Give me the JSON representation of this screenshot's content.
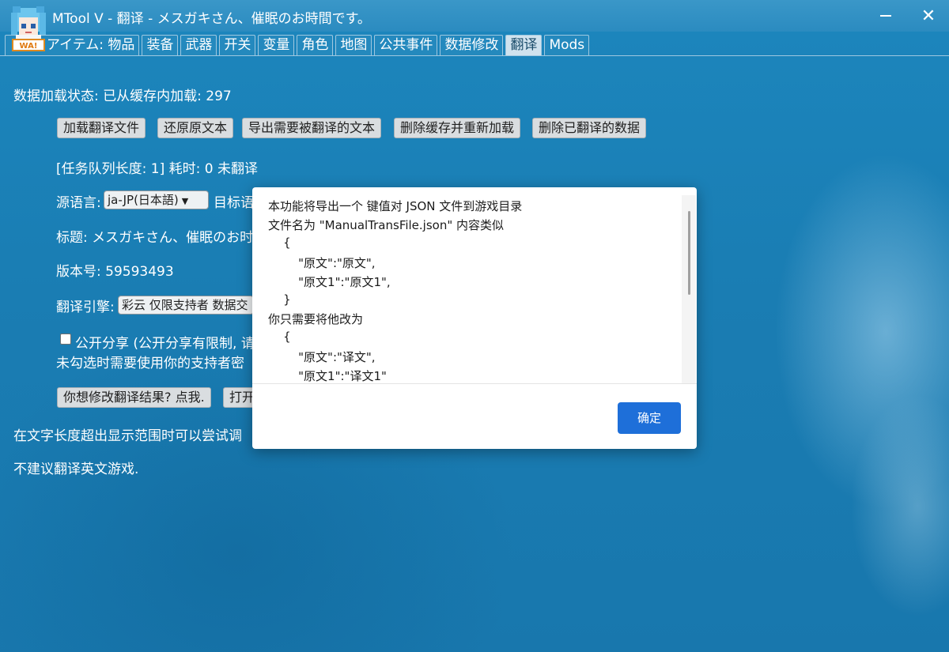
{
  "window": {
    "title": "MTool V - 翻译 - メスガキさん、催眠のお時間です。",
    "minimize_label": "—",
    "close_label": "✕"
  },
  "tabs": [
    {
      "label": "アイテム: 物品",
      "active": false
    },
    {
      "label": "装备",
      "active": false
    },
    {
      "label": "武器",
      "active": false
    },
    {
      "label": "开关",
      "active": false
    },
    {
      "label": "变量",
      "active": false
    },
    {
      "label": "角色",
      "active": false
    },
    {
      "label": "地图",
      "active": false
    },
    {
      "label": "公共事件",
      "active": false
    },
    {
      "label": "数据修改",
      "active": false
    },
    {
      "label": "翻译",
      "active": true
    },
    {
      "label": "Mods",
      "active": false
    }
  ],
  "translate": {
    "load_status": "数据加载状态: 已从缓存内加载: 297",
    "buttons": {
      "load_file": "加载翻译文件",
      "restore": "还原原文本",
      "export": "导出需要被翻译的文本",
      "clear_cache": "删除缓存并重新加载",
      "delete_translated": "删除已翻译的数据"
    },
    "queue_status": "[任务队列长度: 1] 耗时: 0 未翻译",
    "source_lang_label": "源语言:",
    "source_lang_value": "ja-JP(日本語)",
    "target_lang_label": "目标语",
    "title_line": "标题: メスガキさん、催眠のお时",
    "version_line": "版本号: 59593493",
    "engine_label": "翻译引擎:",
    "engine_value": "彩云 仅限支持者 数据交",
    "share_label": "公开分享 (公开分享有限制, 请",
    "share_note": "未勾选时需要使用你的支持者密",
    "modify_button": "你想修改翻译结果? 点我.",
    "open_button": "打开",
    "hint_length": "在文字长度超出显示范围时可以尝试调",
    "hint_english": "不建议翻译英文游戏."
  },
  "modal": {
    "lines": [
      "本功能将导出一个 键值对 JSON 文件到游戏目录",
      "文件名为 \"ManualTransFile.json\" 内容类似",
      "    {",
      "        \"原文\":\"原文\",",
      "        \"原文1\":\"原文1\",",
      "    }",
      "你只需要将他改为",
      "    {",
      "        \"原文\":\"译文\",",
      "        \"原文1\":\"译文1\""
    ],
    "ok_label": "确定"
  }
}
